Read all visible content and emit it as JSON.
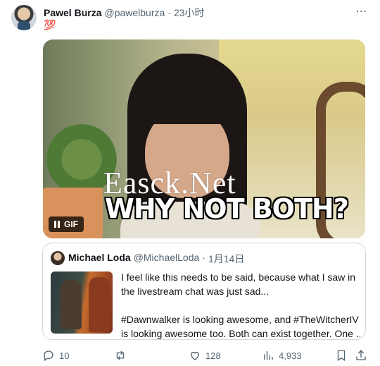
{
  "tweet": {
    "author_name": "Pawel Burza",
    "author_handle": "@pawelburza",
    "separator": "·",
    "time": "23小时",
    "text": "💯",
    "more_icon": "more-horizontal-icon",
    "media": {
      "type": "GIF",
      "badge": "GIF",
      "caption": "WHY NOT BOTH?",
      "watermark": "Easck.Net"
    }
  },
  "quoted": {
    "author_name": "Michael Loda",
    "author_handle": "@MichaelLoda",
    "separator": "·",
    "date": "1月14日",
    "lines": [
      "I feel like this needs to be said, because what I saw in",
      "the livestream chat was just sad...",
      "#Dawnwalker is looking awesome, and #TheWitcherIV",
      "is looking awesome too. Both can exist together. One ..."
    ]
  },
  "actions": {
    "replies": "10",
    "retweets": "",
    "likes": "128",
    "views": "4,933"
  },
  "colors": {
    "accent_text": "#0f1419",
    "muted": "#536471",
    "border": "#cfd9de"
  }
}
